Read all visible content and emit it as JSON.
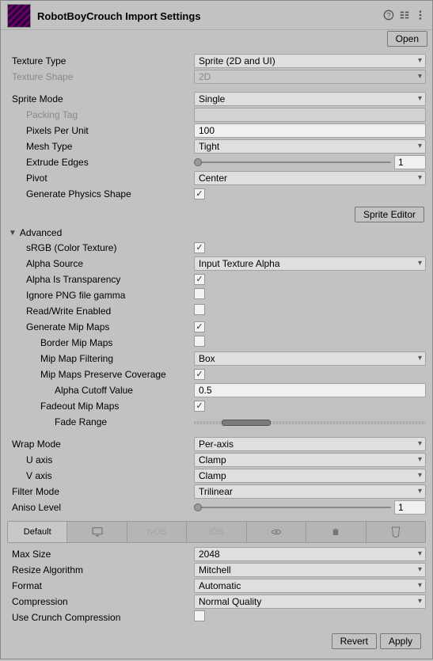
{
  "header": {
    "title": "RobotBoyCrouch Import Settings",
    "open": "Open"
  },
  "textureType": {
    "label": "Texture Type",
    "value": "Sprite (2D and UI)"
  },
  "textureShape": {
    "label": "Texture Shape",
    "value": "2D"
  },
  "spriteMode": {
    "label": "Sprite Mode",
    "value": "Single"
  },
  "packingTag": {
    "label": "Packing Tag",
    "value": ""
  },
  "pixelsPerUnit": {
    "label": "Pixels Per Unit",
    "value": "100"
  },
  "meshType": {
    "label": "Mesh Type",
    "value": "Tight"
  },
  "extrudeEdges": {
    "label": "Extrude Edges",
    "value": "1",
    "pos": 0.02
  },
  "pivot": {
    "label": "Pivot",
    "value": "Center"
  },
  "generatePhysicsShape": {
    "label": "Generate Physics Shape",
    "checked": true
  },
  "spriteEditorBtn": "Sprite Editor",
  "advanced": "Advanced",
  "srgb": {
    "label": "sRGB (Color Texture)",
    "checked": true
  },
  "alphaSource": {
    "label": "Alpha Source",
    "value": "Input Texture Alpha"
  },
  "alphaIsTransparency": {
    "label": "Alpha Is Transparency",
    "checked": true
  },
  "ignorePngGamma": {
    "label": "Ignore PNG file gamma",
    "checked": false
  },
  "readWrite": {
    "label": "Read/Write Enabled",
    "checked": false
  },
  "genMipMaps": {
    "label": "Generate Mip Maps",
    "checked": true
  },
  "borderMipMaps": {
    "label": "Border Mip Maps",
    "checked": false
  },
  "mipMapFiltering": {
    "label": "Mip Map Filtering",
    "value": "Box"
  },
  "mipMapsPreserveCoverage": {
    "label": "Mip Maps Preserve Coverage",
    "checked": true
  },
  "alphaCutoff": {
    "label": "Alpha Cutoff Value",
    "value": "0.5"
  },
  "fadeoutMipMaps": {
    "label": "Fadeout Mip Maps",
    "checked": true
  },
  "fadeRange": {
    "label": "Fade Range",
    "lowPos": 0.12,
    "highPos": 0.33
  },
  "wrapMode": {
    "label": "Wrap Mode",
    "value": "Per-axis"
  },
  "uAxis": {
    "label": "U axis",
    "value": "Clamp"
  },
  "vAxis": {
    "label": "V axis",
    "value": "Clamp"
  },
  "filterMode": {
    "label": "Filter Mode",
    "value": "Trilinear"
  },
  "anisoLevel": {
    "label": "Aniso Level",
    "value": "1",
    "pos": 0.02
  },
  "platformTabs": {
    "default": "Default",
    "tvos": "tvOS",
    "ios": "iOS"
  },
  "maxSize": {
    "label": "Max Size",
    "value": "2048"
  },
  "resizeAlgorithm": {
    "label": "Resize Algorithm",
    "value": "Mitchell"
  },
  "format": {
    "label": "Format",
    "value": "Automatic"
  },
  "compression": {
    "label": "Compression",
    "value": "Normal Quality"
  },
  "useCrunch": {
    "label": "Use Crunch Compression",
    "checked": false
  },
  "footer": {
    "revert": "Revert",
    "apply": "Apply"
  }
}
